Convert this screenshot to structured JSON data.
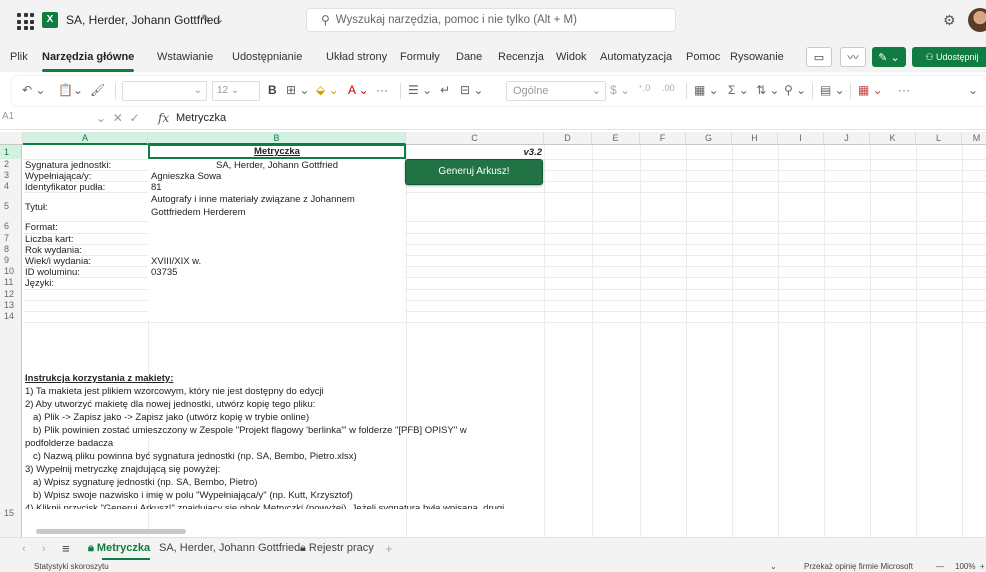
{
  "titlebar": {
    "doc_title": "SA, Herder, Johann Gottfried",
    "search_placeholder": "Wyszukaj narzędzia, pomoc i nie tylko (Alt + M)"
  },
  "menu": {
    "tabs": [
      "Plik",
      "Narzędzia główne",
      "Wstawianie",
      "Udostępnianie",
      "Układ strony",
      "Formuły",
      "Dane",
      "Recenzja",
      "Widok",
      "Automatyzacja",
      "Pomoc",
      "Rysowanie"
    ],
    "share_label": "Udostępnij"
  },
  "ribbon": {
    "font_size": "12",
    "number_format": "Ogólne"
  },
  "formula_bar": {
    "name_box": "A1",
    "fx": "fx",
    "formula": "Metryczka"
  },
  "grid": {
    "columns": [
      "A",
      "B",
      "C",
      "D",
      "E",
      "F",
      "G",
      "H",
      "I",
      "J",
      "K",
      "L",
      "M"
    ],
    "rows": [
      "1",
      "2",
      "3",
      "4",
      "5",
      "6",
      "7",
      "8",
      "9",
      "10",
      "11",
      "12",
      "13",
      "14",
      "15"
    ],
    "b1_title": "Metryczka",
    "version": "v3.2",
    "generate_button": "Generuj Arkusz!",
    "labels": {
      "r2": "Sygnatura jednostki:",
      "r3": "Wypełniająca/y:",
      "r4": "Identyfikator pudła:",
      "r5": "Tytuł:",
      "r6": "Format:",
      "r7": "Liczba kart:",
      "r8": "Rok wydania:",
      "r9": "Wiek/i wydania:",
      "r10": "ID woluminu:",
      "r11": "Języki:"
    },
    "values": {
      "r2": "SA, Herder, Johann Gottfried",
      "r3": "Agnieszka Sowa",
      "r4": "81",
      "r5_line1": "Autografy i inne materiały związane z Johannem",
      "r5_line2": "Gottfriedem Herderem",
      "r9": "XVIII/XIX w.",
      "r10": "03735"
    },
    "instructions": [
      "Instrukcja korzystania z makiety:",
      "1) Ta makieta jest plikiem wzorcowym, który nie jest dostępny do edycji",
      "2) Aby utworzyć makietę dla nowej jednostki, utwórz kopię tego pliku:",
      "a) Plik -> Zapisz jako -> Zapisz jako (utwórz kopię w trybie online)",
      "b) Plik powinien zostać umieszczony w Zespole \"Projekt flagowy 'berlinka'\" w folderze \"[PFB] OPISY\" w",
      "podfolderze badacza",
      "c) Nazwą pliku powinna być sygnatura jednostki (np. SA, Bembo, Pietro.xlsx)",
      "3) Wypełnij metryczkę znajdującą się powyżej:",
      "a) Wpisz sygnaturę jednostki (np. SA, Bembo, Pietro)",
      "b) Wpisz swoje nazwisko i imię w polu \"Wypełniająca/y\" (np. Kutt, Krzysztof)",
      "4) Kliknij przycisk \"Generuj Arkusz!\" znajdujący się obok Metryczki (powyżej). Jeżeli sygnatura była wpisana, drugi"
    ]
  },
  "sheets": {
    "tabs": [
      "Metryczka",
      "SA, Herder, Johann Gottfried",
      "Rejestr pracy"
    ],
    "add": "+"
  },
  "status": {
    "left": "Statystyki skoroszytu",
    "feedback": "Przekaż opinię firmie Microsoft",
    "zoom": "100%"
  }
}
